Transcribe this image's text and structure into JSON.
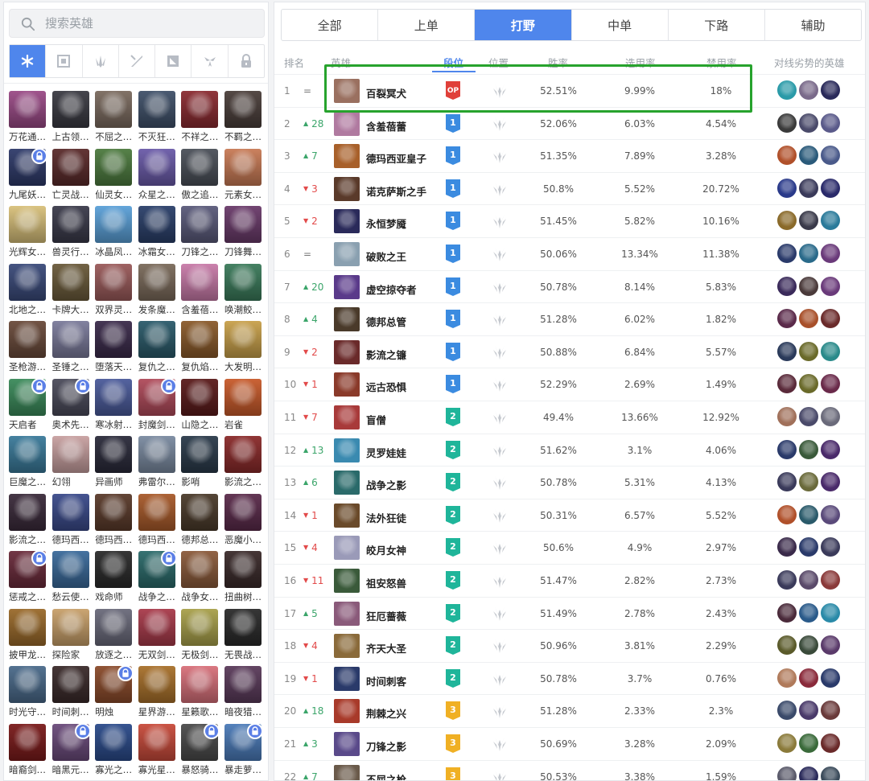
{
  "search": {
    "placeholder": "搜索英雄"
  },
  "filters": [
    {
      "name": "all-icon",
      "active": true
    },
    {
      "name": "tank-icon",
      "active": false
    },
    {
      "name": "fighter-icon",
      "active": false
    },
    {
      "name": "assassin-icon",
      "active": false
    },
    {
      "name": "mage-icon",
      "active": false
    },
    {
      "name": "marksman-icon",
      "active": false
    },
    {
      "name": "support-icon",
      "active": false
    }
  ],
  "champions": [
    {
      "name": "万花通…",
      "color": "#9a4a86",
      "lock": false
    },
    {
      "name": "上古领…",
      "color": "#3a3a42",
      "lock": false
    },
    {
      "name": "不屈之…",
      "color": "#7a6a5e",
      "lock": false
    },
    {
      "name": "不灭狂…",
      "color": "#3f5069",
      "lock": false
    },
    {
      "name": "不祥之…",
      "color": "#8a2a30",
      "lock": false
    },
    {
      "name": "不羁之…",
      "color": "#4a3e3a",
      "lock": false
    },
    {
      "name": "九尾妖…",
      "color": "#2e3a6a",
      "lock": true
    },
    {
      "name": "亡灵战…",
      "color": "#5a2a2a",
      "lock": false
    },
    {
      "name": "仙灵女…",
      "color": "#4c7a3e",
      "lock": false
    },
    {
      "name": "众星之…",
      "color": "#6a5aa8",
      "lock": false
    },
    {
      "name": "傲之追…",
      "color": "#4a4f58",
      "lock": false
    },
    {
      "name": "元素女…",
      "color": "#c87a55",
      "lock": false
    },
    {
      "name": "光辉女…",
      "color": "#d8c07a",
      "lock": false
    },
    {
      "name": "兽灵行…",
      "color": "#3a3a4a",
      "lock": false
    },
    {
      "name": "冰晶凤…",
      "color": "#5aa0d8",
      "lock": false
    },
    {
      "name": "冰霜女…",
      "color": "#2a3f6a",
      "lock": false
    },
    {
      "name": "刀锋之…",
      "color": "#5a5a7a",
      "lock": false
    },
    {
      "name": "刀锋舞…",
      "color": "#6a3a6a",
      "lock": false
    },
    {
      "name": "北地之…",
      "color": "#3a4a7a",
      "lock": false
    },
    {
      "name": "卡牌大…",
      "color": "#6a5a3a",
      "lock": false
    },
    {
      "name": "双界灵…",
      "color": "#9a5a5a",
      "lock": false
    },
    {
      "name": "发条魔…",
      "color": "#7a6a5a",
      "lock": false
    },
    {
      "name": "含羞蓓…",
      "color": "#c87aa8",
      "lock": false
    },
    {
      "name": "唤潮鲛…",
      "color": "#3a7a5a",
      "lock": false
    },
    {
      "name": "圣枪游…",
      "color": "#6a4a3a",
      "lock": false
    },
    {
      "name": "圣锤之…",
      "color": "#7a7a9a",
      "lock": false
    },
    {
      "name": "堕落天…",
      "color": "#3a2a4a",
      "lock": false
    },
    {
      "name": "复仇之…",
      "color": "#2a5a6a",
      "lock": false
    },
    {
      "name": "复仇焰…",
      "color": "#8a5a2a",
      "lock": false
    },
    {
      "name": "大发明…",
      "color": "#c8a04a",
      "lock": false
    },
    {
      "name": "天启者",
      "color": "#3a8a5a",
      "lock": true
    },
    {
      "name": "奥术先…",
      "color": "#4a4a5a",
      "lock": true
    },
    {
      "name": "寒冰射…",
      "color": "#4a5a9a",
      "lock": false
    },
    {
      "name": "封魔剑…",
      "color": "#b04a5a",
      "lock": true
    },
    {
      "name": "山隐之…",
      "color": "#5a1a1a",
      "lock": false
    },
    {
      "name": "岩雀",
      "color": "#c85a2a",
      "lock": false
    },
    {
      "name": "巨魔之…",
      "color": "#3a7a9a",
      "lock": false
    },
    {
      "name": "幻翎",
      "color": "#c8a0a0",
      "lock": false
    },
    {
      "name": "异画师",
      "color": "#2a2a3a",
      "lock": false
    },
    {
      "name": "弗雷尔…",
      "color": "#7a8aa0",
      "lock": false
    },
    {
      "name": "影哨",
      "color": "#2a3a4a",
      "lock": false
    },
    {
      "name": "影流之…",
      "color": "#8a2a2a",
      "lock": false
    },
    {
      "name": "影流之…",
      "color": "#3a2a3a",
      "lock": false
    },
    {
      "name": "德玛西…",
      "color": "#3a4a8a",
      "lock": false
    },
    {
      "name": "德玛西…",
      "color": "#5a3a2a",
      "lock": false
    },
    {
      "name": "德玛西…",
      "color": "#a85a2a",
      "lock": false
    },
    {
      "name": "德邦总…",
      "color": "#4a3a2a",
      "lock": false
    },
    {
      "name": "恶魔小…",
      "color": "#5a2a4a",
      "lock": false
    },
    {
      "name": "惩戒之…",
      "color": "#6a2a3a",
      "lock": true
    },
    {
      "name": "愁云使…",
      "color": "#3a6a9a",
      "lock": false
    },
    {
      "name": "戏命师",
      "color": "#2a2a2a",
      "lock": false
    },
    {
      "name": "战争之…",
      "color": "#2a6a6a",
      "lock": true
    },
    {
      "name": "战争女…",
      "color": "#8a5a3a",
      "lock": false
    },
    {
      "name": "扭曲树…",
      "color": "#3a2a2a",
      "lock": false
    },
    {
      "name": "披甲龙…",
      "color": "#9a6a2a",
      "lock": false
    },
    {
      "name": "探险家",
      "color": "#c8a06a",
      "lock": false
    },
    {
      "name": "放逐之…",
      "color": "#6a6a7a",
      "lock": false
    },
    {
      "name": "无双剑…",
      "color": "#a83a4a",
      "lock": false
    },
    {
      "name": "无极剑…",
      "color": "#a8a04a",
      "lock": false
    },
    {
      "name": "无畏战…",
      "color": "#2a2a2a",
      "lock": false
    },
    {
      "name": "时光守…",
      "color": "#4a6a8a",
      "lock": false
    },
    {
      "name": "时间刺…",
      "color": "#3a2a2a",
      "lock": false
    },
    {
      "name": "明烛",
      "color": "#8a4a2a",
      "lock": true
    },
    {
      "name": "星界游…",
      "color": "#a8702a",
      "lock": false
    },
    {
      "name": "星籁歌…",
      "color": "#d8707a",
      "lock": false
    },
    {
      "name": "暗夜猎…",
      "color": "#5a3a5a",
      "lock": false
    },
    {
      "name": "暗裔剑…",
      "color": "#7a1a1a",
      "lock": false
    },
    {
      "name": "暗黑元…",
      "color": "#6a4a7a",
      "lock": true
    },
    {
      "name": "寡光之…",
      "color": "#2a4a8a",
      "lock": false
    },
    {
      "name": "寡光星…",
      "color": "#c84a3a",
      "lock": false
    },
    {
      "name": "暴怒骑…",
      "color": "#4a4a4a",
      "lock": true
    },
    {
      "name": "暴走萝…",
      "color": "#4a7ab8",
      "lock": true
    }
  ],
  "tabs": [
    {
      "label": "全部",
      "active": false
    },
    {
      "label": "上单",
      "active": false
    },
    {
      "label": "打野",
      "active": true
    },
    {
      "label": "中单",
      "active": false
    },
    {
      "label": "下路",
      "active": false
    },
    {
      "label": "辅助",
      "active": false
    }
  ],
  "table": {
    "headers": {
      "rank": "排名",
      "hero": "英雄",
      "tier": "段位",
      "position": "位置",
      "win": "胜率",
      "pick": "选用率",
      "ban": "禁用率",
      "counters": "对线劣势的英雄"
    },
    "rows": [
      {
        "rank": "1",
        "trend": "eq",
        "trend_val": "=",
        "hero": "百裂冥犬",
        "tier": "OP",
        "tier_color": "#e0403a",
        "win": "52.51%",
        "pick": "9.99%",
        "ban": "18%",
        "hero_color": "#9a7060",
        "counters": [
          "#2a9aa8",
          "#7a6a8a",
          "#2a2a5a"
        ]
      },
      {
        "rank": "2",
        "trend": "up",
        "trend_val": "28",
        "hero": "含羞蓓蕾",
        "tier": "1",
        "tier_color": "#3b8be0",
        "win": "52.06%",
        "pick": "6.03%",
        "ban": "4.54%",
        "hero_color": "#b07aa0",
        "counters": [
          "#3a3a3a",
          "#4a4a6a",
          "#5a5a8a"
        ]
      },
      {
        "rank": "3",
        "trend": "up",
        "trend_val": "7",
        "hero": "德玛西亚皇子",
        "tier": "1",
        "tier_color": "#3b8be0",
        "win": "51.35%",
        "pick": "7.89%",
        "ban": "3.28%",
        "hero_color": "#a8602a",
        "counters": [
          "#b0502a",
          "#2a5a7a",
          "#4a5a8a"
        ]
      },
      {
        "rank": "4",
        "trend": "down",
        "trend_val": "3",
        "hero": "诺克萨斯之手",
        "tier": "1",
        "tier_color": "#3b8be0",
        "win": "50.8%",
        "pick": "5.52%",
        "ban": "20.72%",
        "hero_color": "#5a3a2a",
        "counters": [
          "#2a3a8a",
          "#3a3a5a",
          "#2a2a6a"
        ]
      },
      {
        "rank": "5",
        "trend": "down",
        "trend_val": "2",
        "hero": "永恒梦魇",
        "tier": "1",
        "tier_color": "#3b8be0",
        "win": "51.45%",
        "pick": "5.82%",
        "ban": "10.16%",
        "hero_color": "#2a2a5a",
        "counters": [
          "#8a6a2a",
          "#3a3a4a",
          "#2a7a9a"
        ]
      },
      {
        "rank": "6",
        "trend": "eq",
        "trend_val": "=",
        "hero": "破败之王",
        "tier": "1",
        "tier_color": "#3b8be0",
        "win": "50.06%",
        "pick": "13.34%",
        "ban": "11.38%",
        "hero_color": "#8aa0b0",
        "counters": [
          "#2a3a6a",
          "#2a6a8a",
          "#6a3a7a"
        ]
      },
      {
        "rank": "7",
        "trend": "up",
        "trend_val": "20",
        "hero": "虚空掠夺者",
        "tier": "1",
        "tier_color": "#3b8be0",
        "win": "50.78%",
        "pick": "8.14%",
        "ban": "5.83%",
        "hero_color": "#5a3a8a",
        "counters": [
          "#3a2a5a",
          "#4a3a3a",
          "#6a3a7a"
        ]
      },
      {
        "rank": "8",
        "trend": "up",
        "trend_val": "4",
        "hero": "德邦总管",
        "tier": "1",
        "tier_color": "#3b8be0",
        "win": "51.28%",
        "pick": "6.02%",
        "ban": "1.82%",
        "hero_color": "#4a3a2a",
        "counters": [
          "#5a2a4a",
          "#a8502a",
          "#6a2a2a"
        ]
      },
      {
        "rank": "9",
        "trend": "down",
        "trend_val": "2",
        "hero": "影流之镰",
        "tier": "1",
        "tier_color": "#3b8be0",
        "win": "50.88%",
        "pick": "6.84%",
        "ban": "5.57%",
        "hero_color": "#6a2a2a",
        "counters": [
          "#2a3a5a",
          "#6a6a2a",
          "#2a8a8a"
        ]
      },
      {
        "rank": "10",
        "trend": "down",
        "trend_val": "1",
        "hero": "远古恐惧",
        "tier": "1",
        "tier_color": "#3b8be0",
        "win": "52.29%",
        "pick": "2.69%",
        "ban": "1.49%",
        "hero_color": "#8a3a2a",
        "counters": [
          "#5a2a3a",
          "#6a6a2a",
          "#6a2a4a"
        ]
      },
      {
        "rank": "11",
        "trend": "down",
        "trend_val": "7",
        "hero": "盲僧",
        "tier": "2",
        "tier_color": "#1fb59a",
        "win": "49.4%",
        "pick": "13.66%",
        "ban": "12.92%",
        "hero_color": "#a83a3a",
        "counters": [
          "#a0705a",
          "#4a4a6a",
          "#6a6a7a"
        ]
      },
      {
        "rank": "12",
        "trend": "up",
        "trend_val": "13",
        "hero": "灵罗娃娃",
        "tier": "2",
        "tier_color": "#1fb59a",
        "win": "51.62%",
        "pick": "3.1%",
        "ban": "4.06%",
        "hero_color": "#3a8ab0",
        "counters": [
          "#2a3a6a",
          "#3a5a3a",
          "#4a2a6a"
        ]
      },
      {
        "rank": "13",
        "trend": "up",
        "trend_val": "6",
        "hero": "战争之影",
        "tier": "2",
        "tier_color": "#1fb59a",
        "win": "50.78%",
        "pick": "5.31%",
        "ban": "4.13%",
        "hero_color": "#2a6a6a",
        "counters": [
          "#3a3a5a",
          "#6a6a3a",
          "#4a2a6a"
        ]
      },
      {
        "rank": "14",
        "trend": "down",
        "trend_val": "1",
        "hero": "法外狂徒",
        "tier": "2",
        "tier_color": "#1fb59a",
        "win": "50.31%",
        "pick": "6.57%",
        "ban": "5.52%",
        "hero_color": "#6a4a2a",
        "counters": [
          "#b0502a",
          "#2a5a6a",
          "#5a4a7a"
        ]
      },
      {
        "rank": "15",
        "trend": "down",
        "trend_val": "4",
        "hero": "皎月女神",
        "tier": "2",
        "tier_color": "#1fb59a",
        "win": "50.6%",
        "pick": "4.9%",
        "ban": "2.97%",
        "hero_color": "#9a9ab8",
        "counters": [
          "#3a2a4a",
          "#2a3a6a",
          "#3a3a5a"
        ]
      },
      {
        "rank": "16",
        "trend": "down",
        "trend_val": "11",
        "hero": "祖安怒兽",
        "tier": "2",
        "tier_color": "#1fb59a",
        "win": "51.47%",
        "pick": "2.82%",
        "ban": "2.73%",
        "hero_color": "#3a5a3a",
        "counters": [
          "#3a3a5a",
          "#5a4a6a",
          "#8a3a3a"
        ]
      },
      {
        "rank": "17",
        "trend": "up",
        "trend_val": "5",
        "hero": "狂厄蔷薇",
        "tier": "2",
        "tier_color": "#1fb59a",
        "win": "51.49%",
        "pick": "2.78%",
        "ban": "2.43%",
        "hero_color": "#8a5a7a",
        "counters": [
          "#4a2a3a",
          "#2a5a8a",
          "#2a8aa8"
        ]
      },
      {
        "rank": "18",
        "trend": "down",
        "trend_val": "4",
        "hero": "齐天大圣",
        "tier": "2",
        "tier_color": "#1fb59a",
        "win": "50.96%",
        "pick": "3.81%",
        "ban": "2.29%",
        "hero_color": "#8a6a3a",
        "counters": [
          "#5a5a2a",
          "#3a4a3a",
          "#5a3a6a"
        ]
      },
      {
        "rank": "19",
        "trend": "down",
        "trend_val": "1",
        "hero": "时间刺客",
        "tier": "2",
        "tier_color": "#1fb59a",
        "win": "50.78%",
        "pick": "3.7%",
        "ban": "0.76%",
        "hero_color": "#2a3a6a",
        "counters": [
          "#b07a5a",
          "#8a2a3a",
          "#2a3a6a"
        ]
      },
      {
        "rank": "20",
        "trend": "up",
        "trend_val": "18",
        "hero": "荆棘之兴",
        "tier": "3",
        "tier_color": "#f0b024",
        "win": "51.28%",
        "pick": "2.33%",
        "ban": "2.3%",
        "hero_color": "#a83a2a",
        "counters": [
          "#3a4a6a",
          "#4a3a6a",
          "#6a3a3a"
        ]
      },
      {
        "rank": "21",
        "trend": "up",
        "trend_val": "3",
        "hero": "刀锋之影",
        "tier": "3",
        "tier_color": "#f0b024",
        "win": "50.69%",
        "pick": "3.28%",
        "ban": "2.09%",
        "hero_color": "#5a4a8a",
        "counters": [
          "#8a7a3a",
          "#3a6a3a",
          "#6a2a2a"
        ]
      },
      {
        "rank": "22",
        "trend": "up",
        "trend_val": "7",
        "hero": "不屈之枪",
        "tier": "3",
        "tier_color": "#f0b024",
        "win": "50.53%",
        "pick": "3.38%",
        "ban": "1.59%",
        "hero_color": "#6a5a4a",
        "counters": [
          "#5a5a6a",
          "#2a2a5a",
          "#3a4a5a"
        ]
      }
    ]
  }
}
